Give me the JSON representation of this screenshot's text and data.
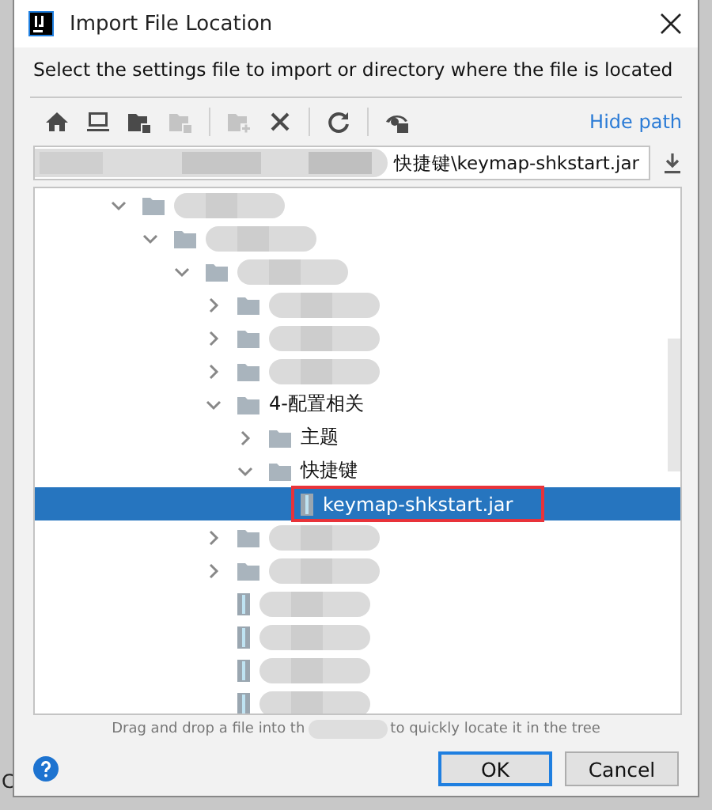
{
  "window": {
    "title": "Import File Location"
  },
  "background_text": "C",
  "description": "Select the settings file to import or directory where the file is located",
  "toolbar": [
    {
      "kind": "home",
      "disabled": false
    },
    {
      "kind": "desktop",
      "disabled": false
    },
    {
      "kind": "folder-module",
      "disabled": false
    },
    {
      "kind": "folder-module",
      "disabled": true
    },
    {
      "kind": "separator"
    },
    {
      "kind": "new-folder",
      "disabled": true
    },
    {
      "kind": "delete",
      "disabled": false
    },
    {
      "kind": "separator"
    },
    {
      "kind": "refresh",
      "disabled": false
    },
    {
      "kind": "separator"
    },
    {
      "kind": "show-hidden",
      "disabled": false
    }
  ],
  "hide_path_link": "Hide path",
  "path_field": {
    "value": "快捷键\\keymap-shkstart.jar",
    "redacted": true
  },
  "tree": [
    {
      "kind": "folder",
      "redacted": true,
      "expanded": true,
      "selected": false,
      "children": [
        {
          "kind": "folder",
          "redacted": true,
          "expanded": true,
          "selected": false,
          "children": [
            {
              "kind": "folder",
              "redacted": true,
              "expanded": true,
              "selected": false,
              "children": [
                {
                  "kind": "folder",
                  "redacted": true,
                  "expanded": false,
                  "selected": false
                },
                {
                  "kind": "folder",
                  "redacted": true,
                  "expanded": false,
                  "selected": false
                },
                {
                  "kind": "folder",
                  "redacted": true,
                  "expanded": false,
                  "selected": false
                },
                {
                  "kind": "folder",
                  "label": "4-配置相关",
                  "expanded": true,
                  "selected": false,
                  "children": [
                    {
                      "kind": "folder",
                      "label": "主题",
                      "expanded": false,
                      "selected": false
                    },
                    {
                      "kind": "folder",
                      "label": "快捷键",
                      "expanded": true,
                      "selected": false,
                      "children": [
                        {
                          "kind": "file",
                          "label": "keymap-shkstart.jar",
                          "selected": true,
                          "highlighted": true
                        }
                      ]
                    }
                  ]
                },
                {
                  "kind": "folder",
                  "redacted": true,
                  "expanded": false,
                  "selected": false
                },
                {
                  "kind": "folder",
                  "redacted": true,
                  "expanded": false,
                  "selected": false
                },
                {
                  "kind": "file",
                  "redacted": true,
                  "selected": false
                },
                {
                  "kind": "file",
                  "redacted": true,
                  "selected": false
                },
                {
                  "kind": "file",
                  "redacted": true,
                  "selected": false
                },
                {
                  "kind": "file",
                  "redacted": true,
                  "selected": false
                }
              ]
            }
          ]
        }
      ]
    }
  ],
  "hint": [
    "Drag and drop a file into th",
    "to quickly locate it in the tree"
  ],
  "buttons": [
    {
      "label": "OK",
      "default": true
    },
    {
      "label": "Cancel",
      "default": false
    }
  ]
}
